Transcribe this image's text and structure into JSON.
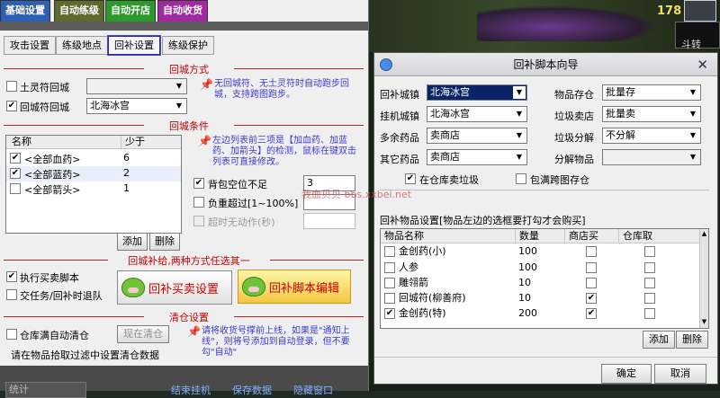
{
  "main_tabs": [
    {
      "label": "基础设置",
      "color": "#2e5fb0"
    },
    {
      "label": "自动练级",
      "color": "#5f6b2e"
    },
    {
      "label": "自动开店",
      "color": "#2e9a2e"
    },
    {
      "label": "自动收货",
      "color": "#a02aa0"
    }
  ],
  "sub_tabs": [
    "攻击设置",
    "练级地点",
    "回补设置",
    "练级保护"
  ],
  "return_method": {
    "title": "回城方式",
    "earth_rune": {
      "label": "土灵符回城",
      "checked": false,
      "value": ""
    },
    "return_rune": {
      "label": "回城符回城",
      "checked": true,
      "value": "北海冰宫"
    },
    "note": "无回城符、无土灵符时自动跑步回城，支持跨图跑步。"
  },
  "return_condition": {
    "title": "回城条件",
    "columns": [
      "名称",
      "少于"
    ],
    "rows": [
      {
        "name": "<全部血药>",
        "value": "6",
        "checked": true
      },
      {
        "name": "<全部蓝药>",
        "value": "2",
        "checked": true
      },
      {
        "name": "<全部箭头>",
        "value": "1",
        "checked": false
      }
    ],
    "note": "左边列表前三项是【加血药、加蓝药、加箭头】的检测，鼠标在键双击列表可直接修改。",
    "bag_full": {
      "label": "背包空位不足",
      "checked": true,
      "value": "3"
    },
    "overweight": {
      "label": "负重超过[1~100%]",
      "checked": false,
      "value": ""
    },
    "timeout": {
      "label": "超时无动作(秒)",
      "checked": false,
      "value": ""
    },
    "add_label": "添加",
    "delete_label": "删除"
  },
  "restock": {
    "title": "回城补给,两种方式任选其一",
    "run_script": {
      "label": "执行买卖脚本",
      "checked": true
    },
    "team_retreat": {
      "label": "交任务/回补时退队",
      "checked": false
    },
    "buy_sell_btn": "回补买卖设置",
    "script_edit_btn": "回补脚本编辑"
  },
  "warehouse": {
    "title": "清仓设置",
    "auto_clear": {
      "label": "仓库满自动清仓",
      "checked": false
    },
    "clear_now": "现在清仓",
    "hint": "请在物品拾取过滤中设置清仓数据",
    "note": "请将收货号撑前上线，如果是\"通知上线\"，则将号添加到自动登录，但不要勾\"自动\""
  },
  "game": {
    "score": "178",
    "tag": "斗转"
  },
  "dialog": {
    "title": "回补脚本向导",
    "fields": [
      {
        "label": "回补城镇",
        "value": "北海冰宫"
      },
      {
        "label": "挂机城镇",
        "value": "北海冰宫"
      },
      {
        "label": "多余药品",
        "value": "卖商店"
      },
      {
        "label": "其它药品",
        "value": "卖商店"
      },
      {
        "label": "物品存仓",
        "value": "批量存"
      },
      {
        "label": "垃圾卖店",
        "value": "批量卖"
      },
      {
        "label": "垃圾分解",
        "value": "不分解"
      },
      {
        "label": "分解物品",
        "value": ""
      }
    ],
    "sell_junk_in_wh": {
      "label": "在仓库卖垃圾",
      "checked": true
    },
    "full_bag_cross": {
      "label": "包满跨图存仓",
      "checked": false
    },
    "items_title": "回补物品设置[物品左边的选框要打勾才会购买]",
    "item_columns": [
      "物品名称",
      "数量",
      "商店买",
      "仓库取"
    ],
    "items": [
      {
        "name": "金创药(小)",
        "qty": "100",
        "buy": false,
        "take": false,
        "checked": false
      },
      {
        "name": "人参",
        "qty": "100",
        "buy": false,
        "take": false,
        "checked": false
      },
      {
        "name": "雕翎箭",
        "qty": "10",
        "buy": false,
        "take": false,
        "checked": false
      },
      {
        "name": "回城符(柳善府)",
        "qty": "10",
        "buy": true,
        "take": false,
        "checked": false
      },
      {
        "name": "金创药(特)",
        "qty": "200",
        "buy": true,
        "take": false,
        "checked": true
      }
    ],
    "add_label": "添加",
    "delete_label": "删除",
    "ok_label": "确定",
    "cancel_label": "取消"
  },
  "watermark": "我血贝贝 bbs.xxbei.net",
  "footer": {
    "left": "统计",
    "mid1": "结束挂机",
    "mid2": "保存数据",
    "mid3": "隐藏窗口"
  }
}
